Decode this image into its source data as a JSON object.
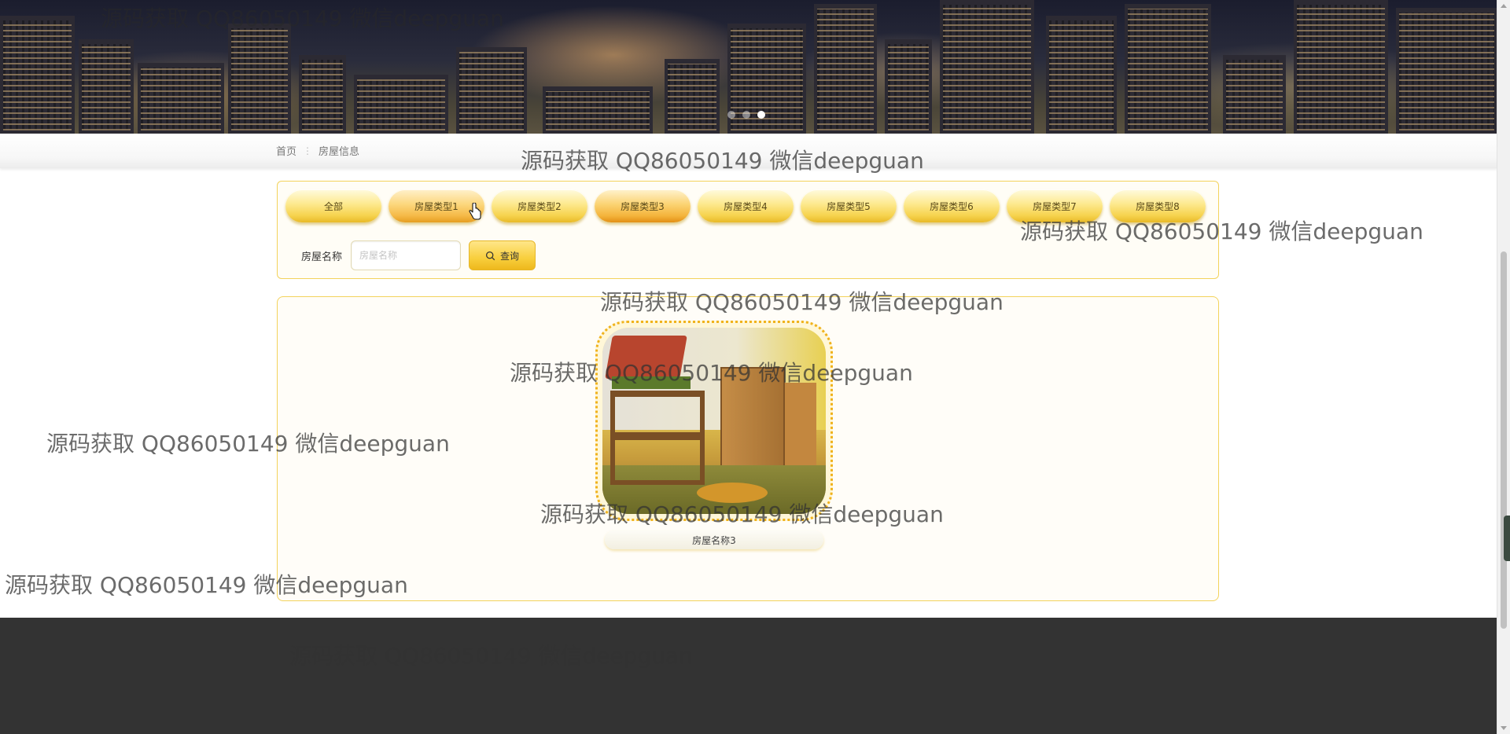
{
  "breadcrumb": {
    "home": "首页",
    "separator": "⋮",
    "current": "房屋信息"
  },
  "filter": {
    "tabs": [
      "全部",
      "房屋类型1",
      "房屋类型2",
      "房屋类型3",
      "房屋类型4",
      "房屋类型5",
      "房屋类型6",
      "房屋类型7",
      "房屋类型8"
    ],
    "search_label": "房屋名称",
    "search_placeholder": "房屋名称",
    "search_value": "",
    "search_button": "查询"
  },
  "list": {
    "items": [
      {
        "title": "房屋名称3"
      }
    ]
  },
  "carousel": {
    "slides": 3,
    "active": 3
  },
  "watermark": "源码获取 QQ86050149 微信deepguan",
  "colors": {
    "accent": "#f6d24d",
    "border": "#f3d35c",
    "footer": "#333333"
  }
}
